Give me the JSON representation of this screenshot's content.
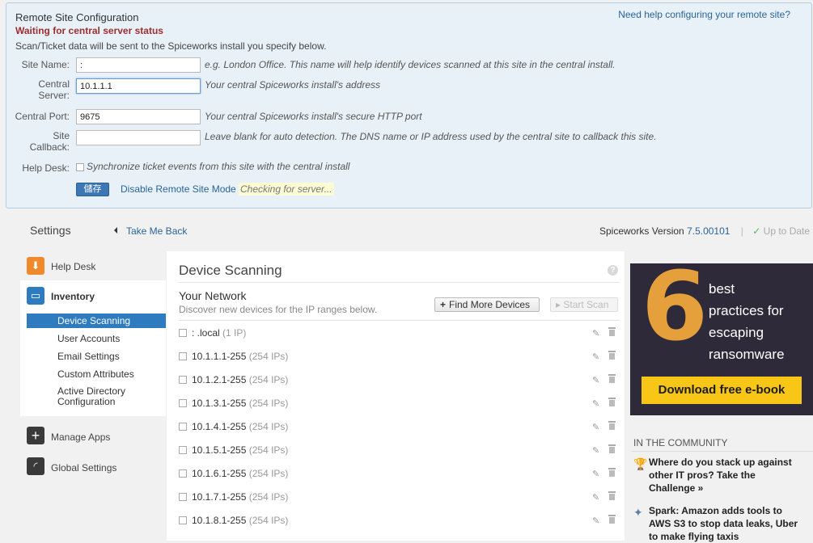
{
  "remote": {
    "title": "Remote Site Configuration",
    "status": "Waiting for central server status",
    "description": "Scan/Ticket data will be sent to the Spiceworks install you specify below.",
    "help_link": "Need help configuring your remote site?",
    "site_name": {
      "label": "Site Name:",
      "value": ":",
      "hint": "e.g. London Office. This name will help identify devices scanned at this site in the central install."
    },
    "central_server": {
      "label_line1": "Central",
      "label_line2": "Server:",
      "value": "10.1.1.1",
      "hint": "Your central Spiceworks install's address"
    },
    "central_port": {
      "label": "Central Port:",
      "value": "9675",
      "hint": "Your central Spiceworks install's secure HTTP port"
    },
    "site_callback": {
      "label_line1": "Site",
      "label_line2": "Callback:",
      "value": "",
      "hint": "Leave blank for auto detection. The DNS name or IP address used by the central site to callback this site."
    },
    "help_desk": {
      "label": "Help Desk:",
      "checkbox_text": "Synchronize ticket events from this site with the central install"
    },
    "save_label": "儲存",
    "disable_link": "Disable Remote Site Mode",
    "checking_text": "Checking for server..."
  },
  "header": {
    "settings_title": "Settings",
    "back_link": "Take Me Back",
    "version_label": "Spiceworks Version",
    "version_number": "7.5.00101",
    "separator": "|",
    "up_to_date": "Up to Date"
  },
  "nav": {
    "help_desk": "Help Desk",
    "inventory": "Inventory",
    "inventory_items": [
      "Device Scanning",
      "User Accounts",
      "Email Settings",
      "Custom Attributes",
      "Active Directory",
      "Configuration"
    ],
    "manage_apps": "Manage Apps",
    "global_settings": "Global Settings",
    "colors": {
      "help_desk": "#f0892b",
      "inventory": "#2f7bbf",
      "manage_apps": "#3a3a3a",
      "global_settings": "#3a3a3a"
    }
  },
  "main": {
    "title": "Device Scanning",
    "help_icon": "?",
    "network_title": "Your Network",
    "network_desc": "Discover new devices for the IP ranges below.",
    "find_more_label": "Find More Devices",
    "start_scan_label": "Start Scan",
    "ranges": [
      {
        "name": ":            .local",
        "count": "(1 IP)"
      },
      {
        "name": "10.1.1.1-255",
        "count": "(254 IPs)"
      },
      {
        "name": "10.1.2.1-255",
        "count": "(254 IPs)"
      },
      {
        "name": "10.1.3.1-255",
        "count": "(254 IPs)"
      },
      {
        "name": "10.1.4.1-255",
        "count": "(254 IPs)"
      },
      {
        "name": "10.1.5.1-255",
        "count": "(254 IPs)"
      },
      {
        "name": "10.1.6.1-255",
        "count": "(254 IPs)"
      },
      {
        "name": "10.1.7.1-255",
        "count": "(254 IPs)"
      },
      {
        "name": "10.1.8.1-255",
        "count": "(254 IPs)"
      }
    ]
  },
  "ad": {
    "big_number": "6",
    "line1": "best",
    "line2": "practices for",
    "line3": "escaping",
    "line4": "ransomware",
    "button": "Download free e-book"
  },
  "community": {
    "title": "IN THE COMMUNITY",
    "items": [
      {
        "icon": "trophy-icon",
        "line1": "Where do you stack up against",
        "line2": "other IT pros? Take the",
        "line3": "Challenge »"
      },
      {
        "icon": "spark-icon",
        "line1": "Spark: Amazon adds tools to",
        "line2": "AWS S3 to stop data leaks, Uber",
        "line3": "to make flying taxis"
      }
    ]
  }
}
